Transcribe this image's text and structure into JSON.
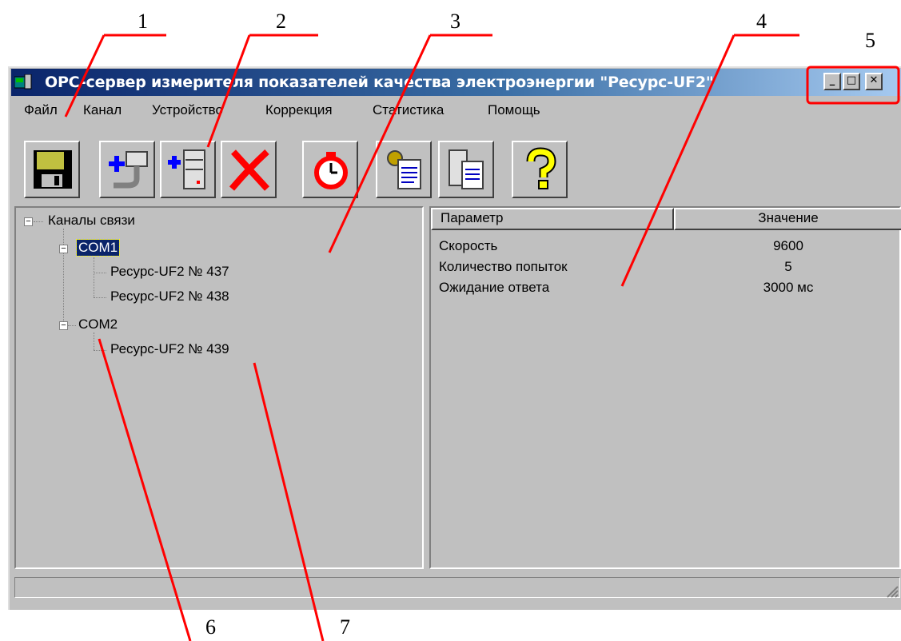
{
  "window": {
    "title": "OPC-сервер измерителя показателей качества электроэнергии \"Ресурс-UF2\"",
    "minimize_glyph": "_",
    "maximize_glyph": "□",
    "close_glyph": "✕"
  },
  "menu": [
    "Файл",
    "Канал",
    "Устройство",
    "Коррекция",
    "Статистика",
    "Помощь"
  ],
  "toolbar": [
    "save-icon",
    "add-channel-icon",
    "add-device-icon",
    "delete-icon",
    "timer-icon",
    "settings-document-icon",
    "device-document-icon",
    "help-icon"
  ],
  "tree": {
    "root": "Каналы связи",
    "channels": [
      {
        "label": "COM1",
        "selected": true,
        "devices": [
          "Ресурс-UF2 № 437",
          "Ресурс-UF2 № 438"
        ]
      },
      {
        "label": "COM2",
        "selected": false,
        "devices": [
          "Ресурс-UF2 № 439"
        ]
      }
    ]
  },
  "table": {
    "headers": [
      "Параметр",
      "Значение"
    ],
    "rows": [
      [
        "Скорость",
        "9600"
      ],
      [
        "Количество попыток",
        "5"
      ],
      [
        "Ожидание ответа",
        "3000 мс"
      ]
    ]
  },
  "callouts": [
    "1",
    "2",
    "3",
    "4",
    "5",
    "6",
    "7"
  ],
  "colors": {
    "highlight": "#ff0000",
    "selection": "#0a246a"
  }
}
